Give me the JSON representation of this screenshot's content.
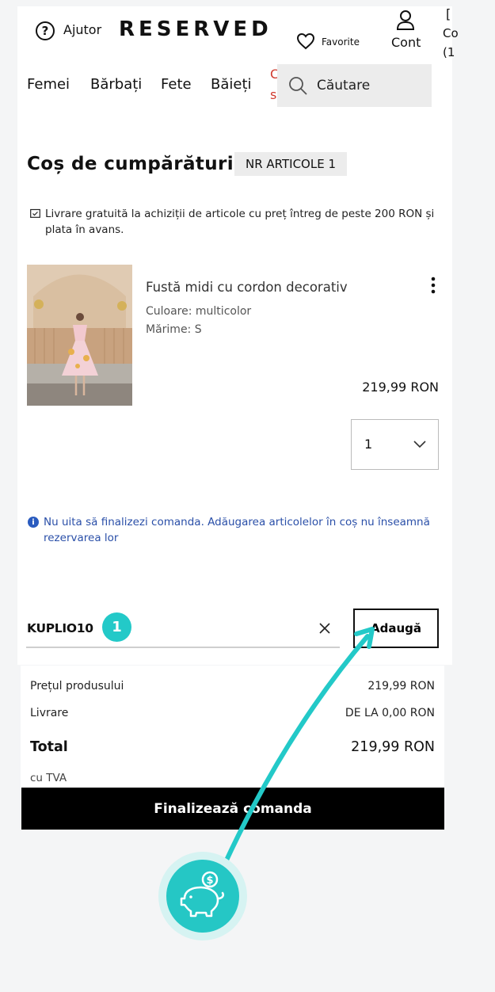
{
  "header": {
    "help_label": "Ajutor",
    "help_icon": "question-circle-icon",
    "logo": "RESERVED",
    "favorites_label": "Favorite",
    "account_label": "Cont",
    "cart_partial": [
      "[",
      "Co",
      "(1"
    ]
  },
  "nav": {
    "items": [
      "Femei",
      "Bărbați",
      "Fete",
      "Băieți"
    ],
    "partial_red": [
      "C",
      "s"
    ],
    "search_label": "Căutare"
  },
  "cart": {
    "title": "Coș de cumpărături",
    "count_label": "NR ARTICOLE 1",
    "shipping_note": "Livrare gratuită la achiziții de articole cu preț întreg de peste 200 RON și plata în avans.",
    "item": {
      "name": "Fustă midi cu cordon decorativ",
      "color": "Culoare: multicolor",
      "size": "Mărime: S",
      "price": "219,99 RON",
      "quantity": "1"
    },
    "reminder": "Nu uita să finalizezi comanda. Adăugarea articolelor în coș nu înseamnă rezervarea lor"
  },
  "promo": {
    "code_value": "KUPLIO10",
    "add_label": "Adaugă",
    "step_number": "1"
  },
  "summary": {
    "product_price_label": "Prețul produsului",
    "product_price_value": "219,99 RON",
    "delivery_label": "Livrare",
    "delivery_value": "DE LA 0,00 RON",
    "total_label": "Total",
    "total_value": "219,99 RON",
    "vat_label": "cu TVA",
    "checkout_label": "Finalizează comanda"
  },
  "colors": {
    "accent_teal": "#23c9c8",
    "info_blue": "#2a4fa8",
    "sale_red": "#d03a2e"
  },
  "icons": [
    "question-circle-icon",
    "heart-icon",
    "user-icon",
    "search-icon",
    "bag-icon",
    "info-icon",
    "close-icon",
    "chevron-down-icon",
    "more-vertical-icon",
    "piggy-bank-icon"
  ]
}
